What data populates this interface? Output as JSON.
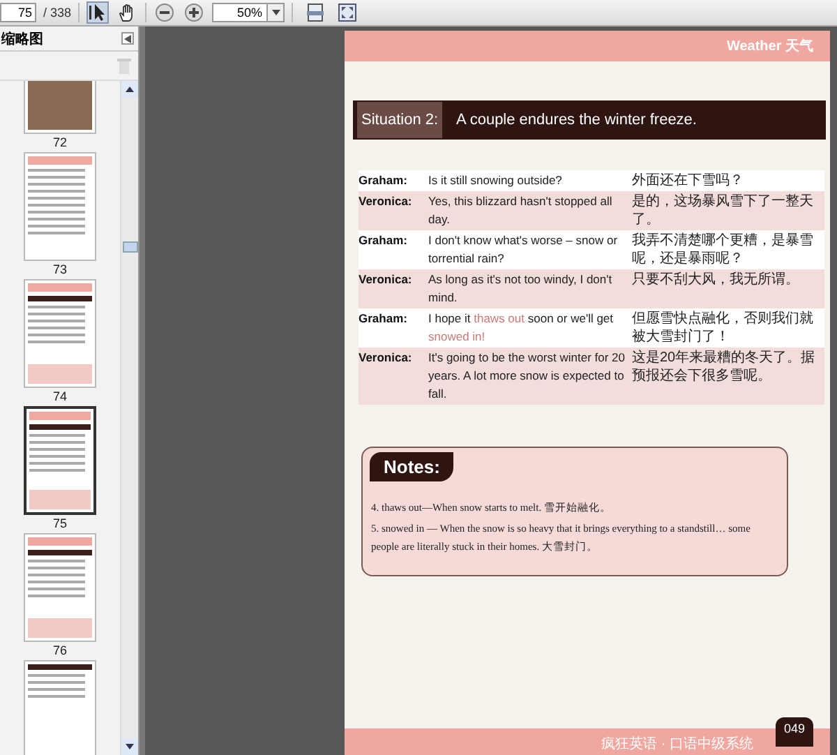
{
  "toolbar": {
    "page_number": "75",
    "page_total": "/ 338",
    "zoom": "50%",
    "tools": [
      {
        "kind": "select",
        "selected": true
      },
      {
        "kind": "hand",
        "selected": false
      }
    ]
  },
  "sidebar": {
    "title": "缩略图",
    "thumbnails": [
      {
        "label": "72",
        "kind": "photo",
        "selected": false
      },
      {
        "label": "73",
        "kind": "drawing",
        "selected": false
      },
      {
        "label": "74",
        "kind": "dialogue",
        "selected": false
      },
      {
        "label": "75",
        "kind": "dialogue",
        "selected": true
      },
      {
        "label": "76",
        "kind": "dialogue",
        "selected": false
      },
      {
        "kind": "text",
        "selected": false
      }
    ]
  },
  "page": {
    "header": "Weather 天气",
    "situation": {
      "label": "Situation 2:",
      "title": "A couple endures the winter freeze."
    },
    "dialogue": [
      {
        "speaker": "Graham:",
        "english": "Is it still snowing outside?",
        "chinese": "外面还在下雪吗？",
        "shaded": false
      },
      {
        "speaker": "Veronica:",
        "english": "Yes, this blizzard hasn't stopped all day.",
        "chinese": "是的，这场暴风雪下了一整天了。",
        "shaded": true
      },
      {
        "speaker": "Graham:",
        "english": "I don't know what's worse – snow or torrential rain?",
        "chinese": "我弄不清楚哪个更糟，是暴雪呢，还是暴雨呢？",
        "shaded": false
      },
      {
        "speaker": "Veronica:",
        "english": "As long as it's not too windy, I don't mind.",
        "chinese": "只要不刮大风，我无所谓。",
        "shaded": true
      },
      {
        "speaker": "Graham:",
        "english": "I hope it **thaws out** soon or we'll get **snowed in!**",
        "chinese": "但愿雪快点融化，否则我们就被大雪封门了！",
        "shaded": false
      },
      {
        "speaker": "Veronica:",
        "english": "It's going to be the worst winter for 20 years. A lot more snow is expected to fall.",
        "chinese": "这是20年来最糟的冬天了。据预报还会下很多雪呢。",
        "shaded": true
      }
    ],
    "notes": {
      "heading": "Notes:",
      "items": [
        "4. thaws out—When snow starts to melt. 雪开始融化。",
        "5. snowed in — When the snow is so heavy that it brings everything to a standstill… some people are literally stuck in their homes. 大雪封门。"
      ]
    },
    "footer": {
      "text": "疯狂英语 · 口语中级系统",
      "page_number": "049"
    }
  }
}
